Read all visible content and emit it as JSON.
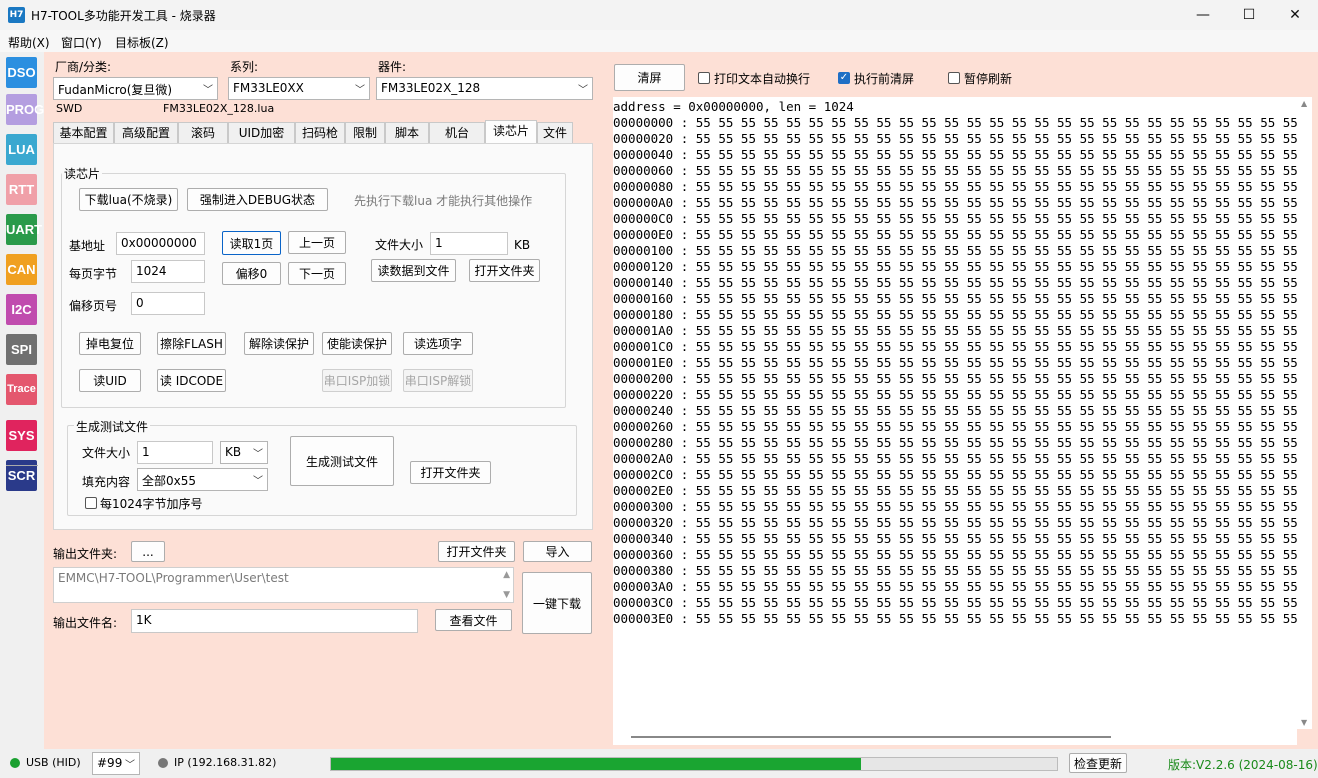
{
  "window": {
    "icon_text": "H7",
    "title": "H7-TOOL多功能开发工具 - 烧录器",
    "minimize": "—",
    "maximize": "☐",
    "close": "✕"
  },
  "menu": [
    "帮助(X)",
    "窗口(Y)",
    "目标板(Z)"
  ],
  "sidebar": [
    {
      "label": "DSO",
      "color": "#2b8fe0"
    },
    {
      "label": "PROG",
      "color": "#b49ee0"
    },
    {
      "label": "LUA",
      "color": "#3aa8d0"
    },
    {
      "label": "RTT",
      "color": "#f0a0a8"
    },
    {
      "label": "UART",
      "color": "#2a9a4a"
    },
    {
      "label": "CAN",
      "color": "#f0a020"
    },
    {
      "label": "I2C",
      "color": "#c04cae"
    },
    {
      "label": "SPI",
      "color": "#707070"
    },
    {
      "label": "Trace",
      "color": "#e4576e"
    },
    {
      "label": "SYS",
      "color": "#e0245e"
    },
    {
      "label": "SCR",
      "color": "#2a3a8a"
    }
  ],
  "device": {
    "vendor_label": "厂商/分类:",
    "vendor_value": "FudanMicro(复旦微)",
    "series_label": "系列:",
    "series_value": "FM33LE0XX",
    "part_label": "器件:",
    "part_value": "FM33LE02X_128",
    "interface": "SWD",
    "lua_file": "FM33LE02X_128.lua"
  },
  "tabs": [
    {
      "label": "基本配置"
    },
    {
      "label": "高级配置"
    },
    {
      "label": "滚码"
    },
    {
      "label": "UID加密"
    },
    {
      "label": "扫码枪"
    },
    {
      "label": "限制"
    },
    {
      "label": "脚本"
    },
    {
      "label": "机台"
    },
    {
      "label": "读芯片"
    },
    {
      "label": "文件"
    }
  ],
  "read_chip": {
    "group_title": "读芯片",
    "download_lua": "下载lua(不烧录)",
    "force_debug": "强制进入DEBUG状态",
    "hint": "先执行下载lua 才能执行其他操作",
    "base_addr_label": "基地址",
    "base_addr_value": "0x00000000",
    "read_page": "读取1页",
    "prev_page": "上一页",
    "file_size_label": "文件大小",
    "file_size_value": "1",
    "kb": "KB",
    "page_bytes_label": "每页字节",
    "page_bytes_value": "1024",
    "offset0": "偏移0",
    "next_page": "下一页",
    "read_to_file": "读数据到文件",
    "open_folder": "打开文件夹",
    "offset_page_label": "偏移页号",
    "offset_page_value": "0",
    "power_reset": "掉电复位",
    "erase_flash": "擦除FLASH",
    "unlock_read": "解除读保护",
    "enable_read_protect": "使能读保护",
    "read_option_bytes": "读选项字",
    "read_uid": "读UID",
    "read_idcode": "读 IDCODE",
    "uart_isp_lock": "串口ISP加锁",
    "uart_isp_unlock": "串口ISP解锁"
  },
  "gen_test": {
    "group_title": "生成测试文件",
    "size_label": "文件大小",
    "size_value": "1",
    "unit_value": "KB",
    "fill_label": "填充内容",
    "fill_value": "全部0x55",
    "seq_label": "每1024字节加序号",
    "seq_checked": false,
    "generate": "生成测试文件",
    "open_folder": "打开文件夹"
  },
  "output": {
    "folder_label": "输出文件夹:",
    "browse": "...",
    "open_folder": "打开文件夹",
    "import": "导入",
    "path": "EMMC\\H7-TOOL\\Programmer\\User\\test",
    "one_key": "一键下载",
    "filename_label": "输出文件名:",
    "filename_value": "1K",
    "view_file": "查看文件"
  },
  "console": {
    "clear": "清屏",
    "auto_wrap_label": "打印文本自动换行",
    "auto_wrap": false,
    "clear_before_label": "执行前清屏",
    "clear_before": true,
    "pause_label": "暂停刷新",
    "pause": false,
    "header": "address = 0x00000000, len = 1024",
    "rows": [
      "00000000 : 55 55 55 55 55 55 55 55 55 55 55 55 55 55 55 55 55 55 55 55 55 55 55 55 55 55 55 55 55 55 55 55",
      "00000020 : 55 55 55 55 55 55 55 55 55 55 55 55 55 55 55 55 55 55 55 55 55 55 55 55 55 55 55 55 55 55 55 55",
      "00000040 : 55 55 55 55 55 55 55 55 55 55 55 55 55 55 55 55 55 55 55 55 55 55 55 55 55 55 55 55 55 55 55 55",
      "00000060 : 55 55 55 55 55 55 55 55 55 55 55 55 55 55 55 55 55 55 55 55 55 55 55 55 55 55 55 55 55 55 55 55",
      "00000080 : 55 55 55 55 55 55 55 55 55 55 55 55 55 55 55 55 55 55 55 55 55 55 55 55 55 55 55 55 55 55 55 55",
      "000000A0 : 55 55 55 55 55 55 55 55 55 55 55 55 55 55 55 55 55 55 55 55 55 55 55 55 55 55 55 55 55 55 55 55",
      "000000C0 : 55 55 55 55 55 55 55 55 55 55 55 55 55 55 55 55 55 55 55 55 55 55 55 55 55 55 55 55 55 55 55 55",
      "000000E0 : 55 55 55 55 55 55 55 55 55 55 55 55 55 55 55 55 55 55 55 55 55 55 55 55 55 55 55 55 55 55 55 55",
      "00000100 : 55 55 55 55 55 55 55 55 55 55 55 55 55 55 55 55 55 55 55 55 55 55 55 55 55 55 55 55 55 55 55 55",
      "00000120 : 55 55 55 55 55 55 55 55 55 55 55 55 55 55 55 55 55 55 55 55 55 55 55 55 55 55 55 55 55 55 55 55",
      "00000140 : 55 55 55 55 55 55 55 55 55 55 55 55 55 55 55 55 55 55 55 55 55 55 55 55 55 55 55 55 55 55 55 55",
      "00000160 : 55 55 55 55 55 55 55 55 55 55 55 55 55 55 55 55 55 55 55 55 55 55 55 55 55 55 55 55 55 55 55 55",
      "00000180 : 55 55 55 55 55 55 55 55 55 55 55 55 55 55 55 55 55 55 55 55 55 55 55 55 55 55 55 55 55 55 55 55",
      "000001A0 : 55 55 55 55 55 55 55 55 55 55 55 55 55 55 55 55 55 55 55 55 55 55 55 55 55 55 55 55 55 55 55 55",
      "000001C0 : 55 55 55 55 55 55 55 55 55 55 55 55 55 55 55 55 55 55 55 55 55 55 55 55 55 55 55 55 55 55 55 55",
      "000001E0 : 55 55 55 55 55 55 55 55 55 55 55 55 55 55 55 55 55 55 55 55 55 55 55 55 55 55 55 55 55 55 55 55",
      "00000200 : 55 55 55 55 55 55 55 55 55 55 55 55 55 55 55 55 55 55 55 55 55 55 55 55 55 55 55 55 55 55 55 55",
      "00000220 : 55 55 55 55 55 55 55 55 55 55 55 55 55 55 55 55 55 55 55 55 55 55 55 55 55 55 55 55 55 55 55 55",
      "00000240 : 55 55 55 55 55 55 55 55 55 55 55 55 55 55 55 55 55 55 55 55 55 55 55 55 55 55 55 55 55 55 55 55",
      "00000260 : 55 55 55 55 55 55 55 55 55 55 55 55 55 55 55 55 55 55 55 55 55 55 55 55 55 55 55 55 55 55 55 55",
      "00000280 : 55 55 55 55 55 55 55 55 55 55 55 55 55 55 55 55 55 55 55 55 55 55 55 55 55 55 55 55 55 55 55 55",
      "000002A0 : 55 55 55 55 55 55 55 55 55 55 55 55 55 55 55 55 55 55 55 55 55 55 55 55 55 55 55 55 55 55 55 55",
      "000002C0 : 55 55 55 55 55 55 55 55 55 55 55 55 55 55 55 55 55 55 55 55 55 55 55 55 55 55 55 55 55 55 55 55",
      "000002E0 : 55 55 55 55 55 55 55 55 55 55 55 55 55 55 55 55 55 55 55 55 55 55 55 55 55 55 55 55 55 55 55 55",
      "00000300 : 55 55 55 55 55 55 55 55 55 55 55 55 55 55 55 55 55 55 55 55 55 55 55 55 55 55 55 55 55 55 55 55",
      "00000320 : 55 55 55 55 55 55 55 55 55 55 55 55 55 55 55 55 55 55 55 55 55 55 55 55 55 55 55 55 55 55 55 55",
      "00000340 : 55 55 55 55 55 55 55 55 55 55 55 55 55 55 55 55 55 55 55 55 55 55 55 55 55 55 55 55 55 55 55 55",
      "00000360 : 55 55 55 55 55 55 55 55 55 55 55 55 55 55 55 55 55 55 55 55 55 55 55 55 55 55 55 55 55 55 55 55",
      "00000380 : 55 55 55 55 55 55 55 55 55 55 55 55 55 55 55 55 55 55 55 55 55 55 55 55 55 55 55 55 55 55 55 55",
      "000003A0 : 55 55 55 55 55 55 55 55 55 55 55 55 55 55 55 55 55 55 55 55 55 55 55 55 55 55 55 55 55 55 55 55",
      "000003C0 : 55 55 55 55 55 55 55 55 55 55 55 55 55 55 55 55 55 55 55 55 55 55 55 55 55 55 55 55 55 55 55 55",
      "000003E0 : 55 55 55 55 55 55 55 55 55 55 55 55 55 55 55 55 55 55 55 55 55 55 55 55 55 55 55 55 55 55 55 55"
    ]
  },
  "status": {
    "usb_label": "USB (HID)",
    "usb_color": "#1aa030",
    "device_id": "#99",
    "ip_label": "IP (192.168.31.82)",
    "ip_color": "#777777",
    "progress": 0.73,
    "progress_color": "#1aa531",
    "check_update": "检查更新",
    "version": "版本:V2.2.6 (2024-08-16)",
    "version_color": "#1a8a1a"
  }
}
